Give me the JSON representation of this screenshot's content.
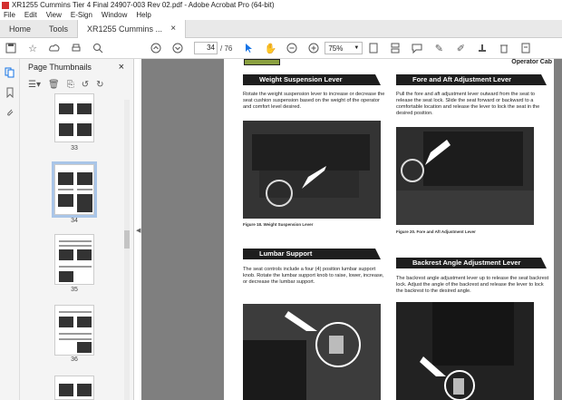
{
  "window": {
    "title": "XR1255 Cummins Tier 4 Final 24907-003 Rev 02.pdf - Adobe Acrobat Pro (64-bit)"
  },
  "menu": [
    "File",
    "Edit",
    "View",
    "E-Sign",
    "Window",
    "Help"
  ],
  "tabs": {
    "home": "Home",
    "tools": "Tools",
    "doc": "XR1255 Cummins ...",
    "close": "×"
  },
  "toolbar": {
    "current_page": "34",
    "total_pages": "/ 76",
    "zoom": "75%"
  },
  "panel": {
    "title": "Page Thumbnails",
    "close": "×",
    "thumbs": [
      {
        "label": "33"
      },
      {
        "label": "34"
      },
      {
        "label": "35"
      },
      {
        "label": "36"
      }
    ]
  },
  "page": {
    "header_right": "Operator Cab",
    "sections": [
      {
        "title": "Weight Suspension Lever",
        "body": "Rotate the weight suspension lever to increase or decrease the seat cushion suspension based on the weight of the operator and comfort level desired.",
        "caption": "Figure 18. Weight Suspension Lever"
      },
      {
        "title": "Fore and Aft Adjustment Lever",
        "body": "Pull the fore and aft adjustment lever outward from the seat to release the seat lock. Slide the seat forward or backward to a comfortable location and release the lever to lock the seat in the desired position.",
        "caption": "Figure 20. Fore and Aft Adjustment Lever"
      },
      {
        "title": "Lumbar Support",
        "body": "The seat controls include a four (4) position lumbar support knob. Rotate the lumbar support knob to raise, lower, increase, or decrease the lumbar support.",
        "caption": ""
      },
      {
        "title": "Backrest Angle Adjustment Lever",
        "body": "The backrest angle adjustment lever up to release the seat backrest lock. Adjust the angle of the backrest and release the lever to lock the backrest to the desired angle.",
        "caption": ""
      }
    ]
  },
  "colors": {
    "accent": "#1473e6",
    "doc_bg": "#7f7f7f",
    "header_bg": "#1e1e1e"
  }
}
